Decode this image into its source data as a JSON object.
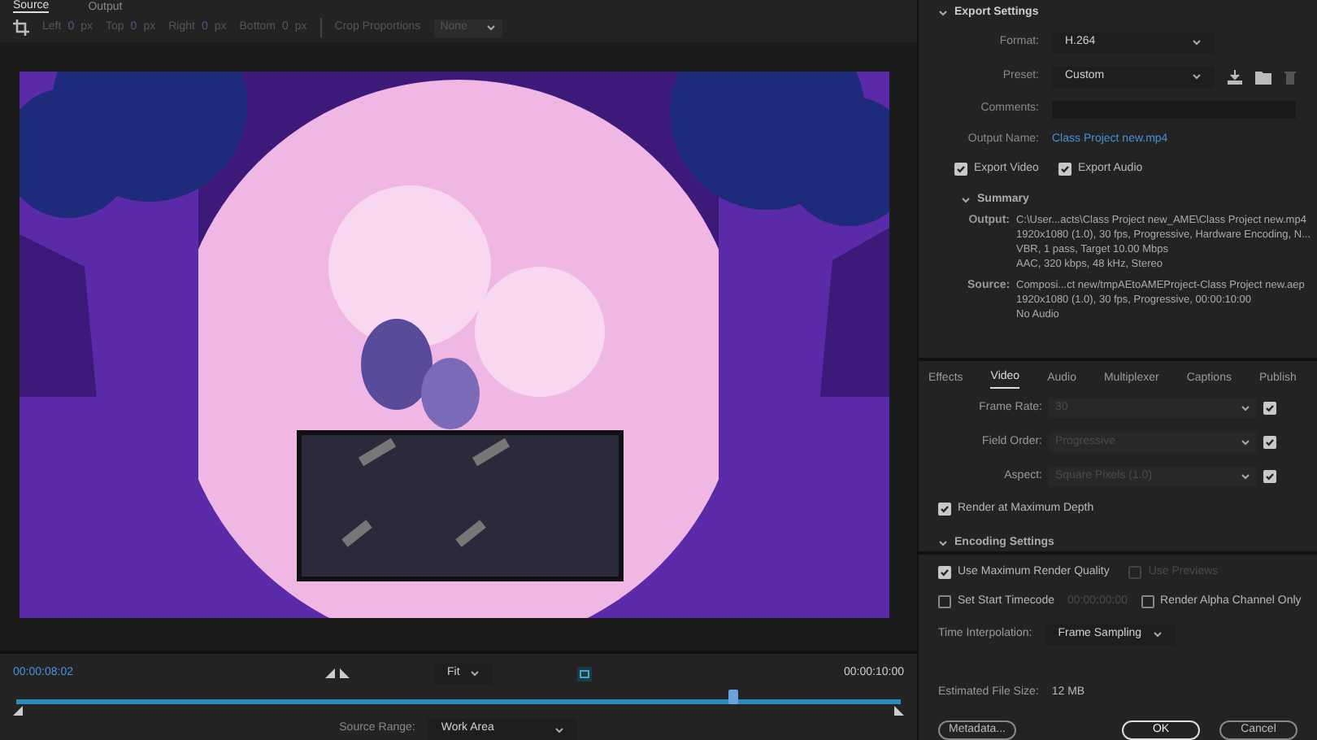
{
  "source_tabs": [
    {
      "label": "Source",
      "selected": true
    },
    {
      "label": "Output",
      "selected": false
    }
  ],
  "crop_toolbar": {
    "fields": [
      {
        "label": "Left",
        "value": "0",
        "unit": "px"
      },
      {
        "label": "Top",
        "value": "0",
        "unit": "px"
      },
      {
        "label": "Right",
        "value": "0",
        "unit": "px"
      },
      {
        "label": "Bottom",
        "value": "0",
        "unit": "px"
      }
    ],
    "proportions_label": "Crop Proportions",
    "proportions_value": "None"
  },
  "timeline": {
    "current_time": "00:00:08:02",
    "zoom": "Fit",
    "end_time": "00:00:10:00",
    "playhead": {
      "level": 0.81
    },
    "source_range_label": "Source Range:",
    "source_range_value": "Work Area"
  },
  "export_settings": {
    "title": "Export Settings",
    "expanded": true,
    "format_label": "Format:",
    "format": "H.264",
    "preset_label": "Preset:",
    "preset": "Custom",
    "comments_label": "Comments:",
    "output_name_label": "Output Name:",
    "output_name": "Class Project new.mp4",
    "export_video": {
      "label": "Export Video",
      "checked": true
    },
    "export_audio": {
      "label": "Export Audio",
      "checked": true
    }
  },
  "summary": {
    "title": "Summary",
    "expanded": true,
    "entries": [
      {
        "label": "Output:",
        "lines": [
          "C:\\User...acts\\Class Project new_AME\\Class Project new.mp4",
          "1920x1080 (1.0), 30 fps, Progressive, Hardware Encoding, N...",
          "VBR, 1 pass, Target 10.00 Mbps",
          "AAC, 320 kbps, 48 kHz, Stereo"
        ]
      },
      {
        "label": "Source:",
        "lines": [
          "Composi...ct new/tmpAEtoAMEProject-Class Project new.aep",
          "1920x1080 (1.0), 30 fps, Progressive, 00:00:10:00",
          "No Audio"
        ]
      }
    ]
  },
  "settings_tabs": [
    {
      "label": "Effects",
      "selected": false
    },
    {
      "label": "Video",
      "selected": true
    },
    {
      "label": "Audio",
      "selected": false
    },
    {
      "label": "Multiplexer",
      "selected": false
    },
    {
      "label": "Captions",
      "selected": false
    },
    {
      "label": "Publish",
      "selected": false
    }
  ],
  "video_settings": [
    {
      "label": "Frame Rate:",
      "value": "30",
      "checked": true
    },
    {
      "label": "Field Order:",
      "value": "Progressive",
      "checked": true
    },
    {
      "label": "Aspect:",
      "value": "Square Pixels (1.0)",
      "checked": true
    }
  ],
  "render_max_depth": {
    "label": "Render at Maximum Depth",
    "checked": true
  },
  "encoding_settings": {
    "title": "Encoding Settings",
    "expanded": true
  },
  "max_render_quality": {
    "label": "Use Maximum Render Quality",
    "checked": true
  },
  "use_previews": {
    "label": "Use Previews",
    "checked": false,
    "disabled": true
  },
  "start_timecode": {
    "label": "Set Start Timecode",
    "checked": false,
    "value": "00:00:00:00"
  },
  "alpha_only": {
    "label": "Render Alpha Channel Only",
    "checked": false
  },
  "time_interpolation": {
    "label": "Time Interpolation:",
    "value": "Frame Sampling"
  },
  "file_size": {
    "label": "Estimated File Size:",
    "value": "12 MB"
  },
  "buttons": [
    {
      "label": "Metadata...",
      "kind": "secondary"
    },
    {
      "label": "OK",
      "kind": "primary"
    },
    {
      "label": "Cancel",
      "kind": "secondary"
    }
  ]
}
